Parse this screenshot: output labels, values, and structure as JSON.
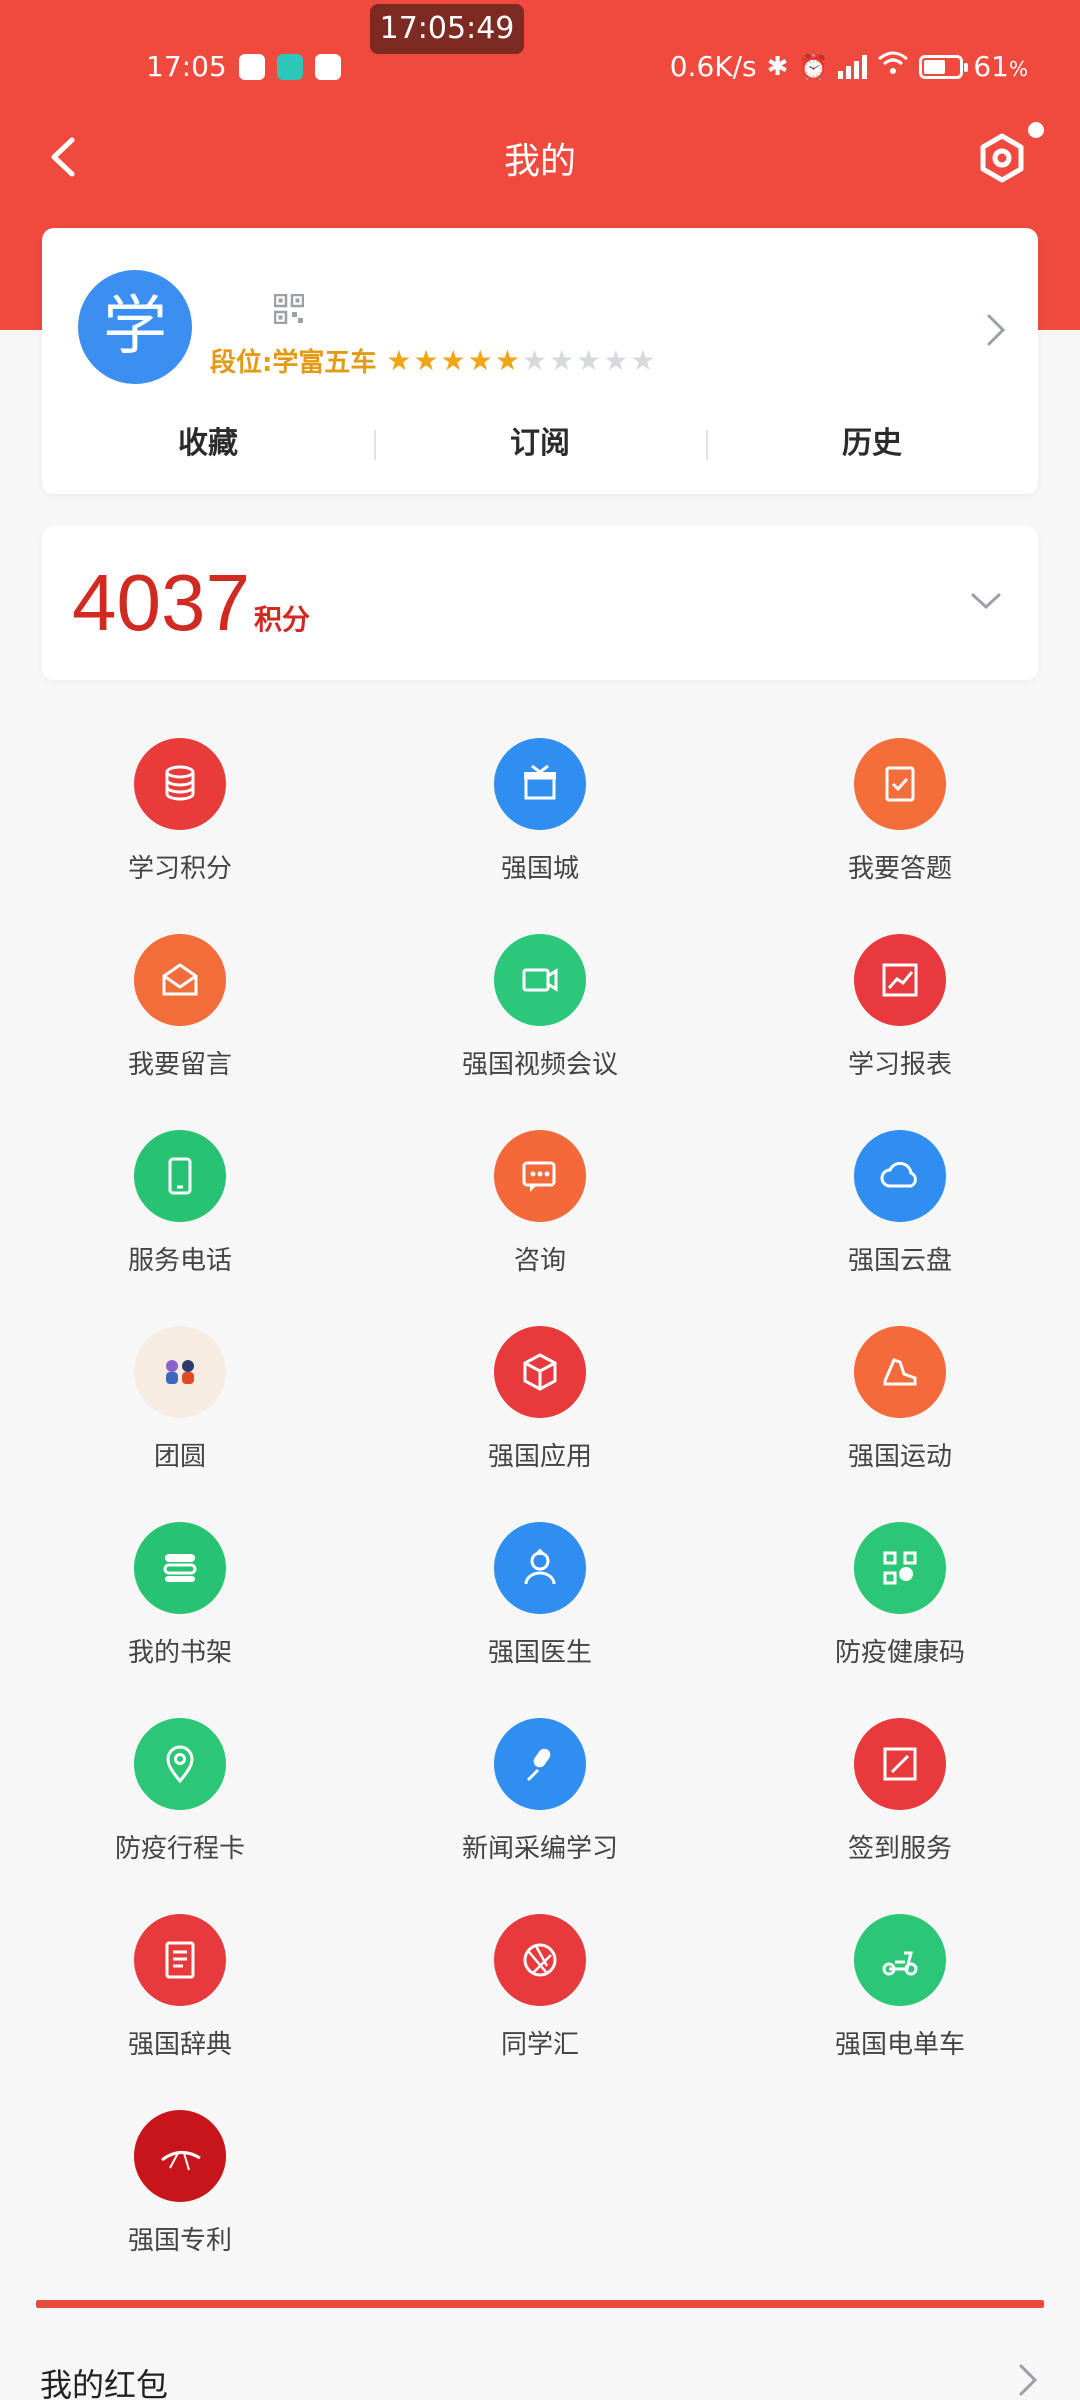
{
  "status_bar": {
    "clock_pill": "17:05:49",
    "time": "17:05",
    "net_speed": "0.6K/s",
    "battery": "61",
    "battery_level": 0.61
  },
  "header": {
    "title": "我的"
  },
  "profile": {
    "avatar_char": "学",
    "rank_label": "段位:学富五车",
    "stars_filled": 5,
    "stars_total": 10,
    "tabs": [
      "收藏",
      "订阅",
      "历史"
    ]
  },
  "points": {
    "value": "4037",
    "unit": "积分"
  },
  "menu": [
    {
      "label": "学习积分",
      "icon": "database-icon",
      "color": "#ea3b3b"
    },
    {
      "label": "强国城",
      "icon": "gift-box-icon",
      "color": "#2f8ef0"
    },
    {
      "label": "我要答题",
      "icon": "clipboard-check-icon",
      "color": "#f46e3a"
    },
    {
      "label": "我要留言",
      "icon": "mail-open-icon",
      "color": "#f26d3a"
    },
    {
      "label": "强国视频会议",
      "icon": "video-camera-icon",
      "color": "#2cc77a"
    },
    {
      "label": "学习报表",
      "icon": "chart-trend-icon",
      "color": "#e83a3e"
    },
    {
      "label": "服务电话",
      "icon": "phone-icon",
      "color": "#27c272"
    },
    {
      "label": "咨询",
      "icon": "chat-icon",
      "color": "#f4683a"
    },
    {
      "label": "强国云盘",
      "icon": "cloud-icon",
      "color": "#2f8ef0"
    },
    {
      "label": "团圆",
      "icon": "reunion-figures-icon",
      "color": "#f6ece2"
    },
    {
      "label": "强国应用",
      "icon": "cube-icon",
      "color": "#e8393c"
    },
    {
      "label": "强国运动",
      "icon": "sneaker-icon",
      "color": "#f46a3a"
    },
    {
      "label": "我的书架",
      "icon": "books-icon",
      "color": "#28c372"
    },
    {
      "label": "强国医生",
      "icon": "doctor-icon",
      "color": "#2f8ef0"
    },
    {
      "label": "防疫健康码",
      "icon": "qr-scan-icon",
      "color": "#2cc677"
    },
    {
      "label": "防疫行程卡",
      "icon": "location-pin-icon",
      "color": "#2cc677"
    },
    {
      "label": "新闻采编学习",
      "icon": "microphone-icon",
      "color": "#2f8ef0"
    },
    {
      "label": "签到服务",
      "icon": "sign-in-icon",
      "color": "#e8393c"
    },
    {
      "label": "强国辞典",
      "icon": "dictionary-icon",
      "color": "#e8393c"
    },
    {
      "label": "同学汇",
      "icon": "aperture-icon",
      "color": "#e8393c"
    },
    {
      "label": "强国电单车",
      "icon": "scooter-icon",
      "color": "#2cc677"
    },
    {
      "label": "强国专利",
      "icon": "patent-logo-icon",
      "color": "#c8151b"
    }
  ],
  "red_packet": {
    "label": "我的红包"
  }
}
